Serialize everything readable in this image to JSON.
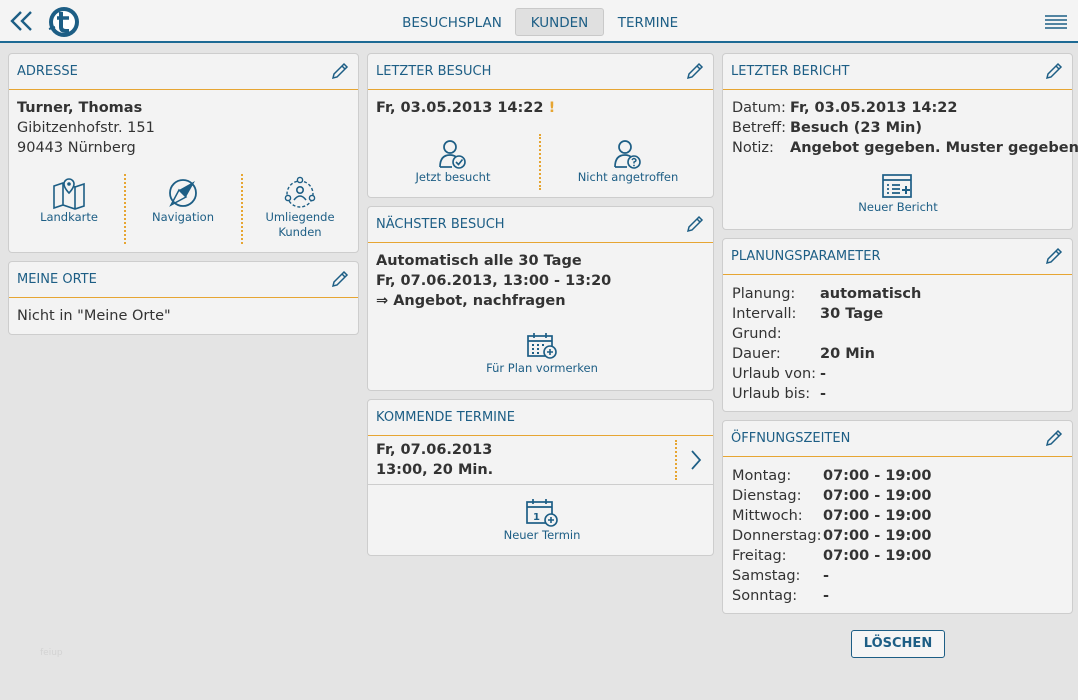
{
  "colors": {
    "accent": "#1d5e85",
    "separator": "#e6a532",
    "background": "#e4e4e4"
  },
  "header": {
    "tabs": [
      {
        "label": "BESUCHSPLAN",
        "active": false
      },
      {
        "label": "KUNDEN",
        "active": true
      },
      {
        "label": "TERMINE",
        "active": false
      }
    ]
  },
  "adresse": {
    "title": "ADRESSE",
    "name": "Turner, Thomas",
    "street": "Gibitzenhofstr. 151",
    "city": "90443 Nürnberg",
    "actions": [
      {
        "label1": "Landkarte",
        "label2": "",
        "icon": "map-icon"
      },
      {
        "label1": "Navigation",
        "label2": "",
        "icon": "compass-icon"
      },
      {
        "label1": "Umliegende",
        "label2": "Kunden",
        "icon": "nearby-customers-icon"
      }
    ]
  },
  "meine_orte": {
    "title": "MEINE ORTE",
    "text": "Nicht in \"Meine Orte\""
  },
  "letzter_besuch": {
    "title": "LETZTER BESUCH",
    "date": "Fr, 03.05.2013 14:22",
    "warning": "!",
    "actions": [
      {
        "label": "Jetzt besucht",
        "icon": "user-check-icon"
      },
      {
        "label": "Nicht angetroffen",
        "icon": "user-question-icon"
      }
    ]
  },
  "naechster_besuch": {
    "title": "NÄCHSTER BESUCH",
    "line1": "Automatisch alle 30 Tage",
    "line2": "Fr, 07.06.2013, 13:00 - 13:20",
    "line3": "⇒ Angebot, nachfragen",
    "action": "Für Plan vormerken"
  },
  "kommende_termine": {
    "title": "KOMMENDE TERMINE",
    "item_date": "Fr, 07.06.2013",
    "item_time": "13:00, 20 Min.",
    "action": "Neuer Termin"
  },
  "letzter_bericht": {
    "title": "LETZTER BERICHT",
    "rows": [
      {
        "label": "Datum:",
        "value": "Fr, 03.05.2013 14:22"
      },
      {
        "label": "Betreff:",
        "value": "Besuch (23 Min)"
      },
      {
        "label": "Notiz:",
        "value": "Angebot gegeben. Muster gegeben."
      }
    ],
    "action": "Neuer Bericht"
  },
  "planungsparameter": {
    "title": "PLANUNGSPARAMETER",
    "rows": [
      {
        "label": "Planung:",
        "value": "automatisch"
      },
      {
        "label": "Intervall:",
        "value": "30 Tage"
      },
      {
        "label": "Grund:",
        "value": ""
      },
      {
        "label": "Dauer:",
        "value": "20 Min"
      },
      {
        "label": "Urlaub von:",
        "value": "-"
      },
      {
        "label": "Urlaub bis:",
        "value": "-"
      }
    ]
  },
  "oeffnungszeiten": {
    "title": "ÖFFNUNGSZEITEN",
    "rows": [
      {
        "label": "Montag:",
        "value": "07:00 - 19:00"
      },
      {
        "label": "Dienstag:",
        "value": "07:00 - 19:00"
      },
      {
        "label": "Mittwoch:",
        "value": "07:00 - 19:00"
      },
      {
        "label": "Donnerstag:",
        "value": "07:00 - 19:00"
      },
      {
        "label": "Freitag:",
        "value": "07:00 - 19:00"
      },
      {
        "label": "Samstag:",
        "value": "-"
      },
      {
        "label": "Sonntag:",
        "value": "-"
      }
    ]
  },
  "delete_label": "LÖSCHEN",
  "footer_text": "feiup"
}
